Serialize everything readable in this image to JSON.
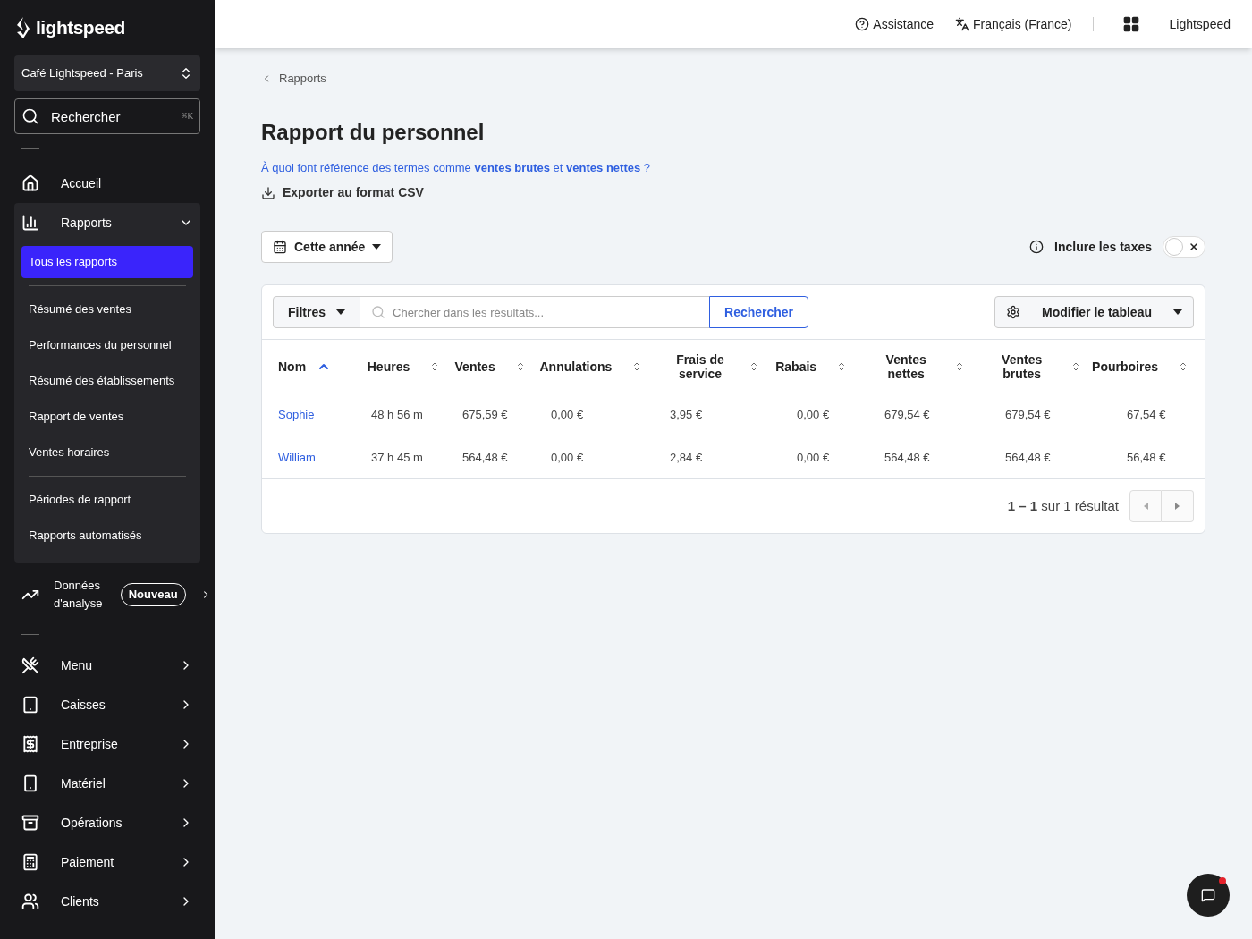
{
  "sidebar": {
    "logo": "lightspeed",
    "location": "Café Lightspeed - Paris",
    "search": {
      "placeholder": "Rechercher",
      "shortcut": "⌘K"
    },
    "items": [
      {
        "kind": "link",
        "label": "Accueil"
      },
      {
        "kind": "group",
        "label": "Rapports",
        "expanded": true,
        "sections": [
          [
            {
              "label": "Tous les rapports",
              "selected": true
            }
          ],
          [
            {
              "label": "Résumé des ventes",
              "selected": false
            },
            {
              "label": "Performances du personnel",
              "selected": false
            },
            {
              "label": "Résumé des établissements",
              "selected": false
            },
            {
              "label": "Rapport de ventes",
              "selected": false
            },
            {
              "label": "Ventes horaires",
              "selected": false
            }
          ],
          [
            {
              "label": "Périodes de rapport",
              "selected": false
            },
            {
              "label": "Rapports automatisés",
              "selected": false
            }
          ]
        ]
      },
      {
        "kind": "badge",
        "label": "Données d'analyse",
        "badge": "Nouveau"
      },
      {
        "kind": "divider"
      },
      {
        "kind": "submenu",
        "label": "Menu"
      },
      {
        "kind": "submenu",
        "label": "Caisses"
      },
      {
        "kind": "submenu",
        "label": "Entreprise"
      },
      {
        "kind": "submenu",
        "label": "Matériel"
      },
      {
        "kind": "submenu",
        "label": "Opérations"
      },
      {
        "kind": "submenu",
        "label": "Paiement"
      },
      {
        "kind": "submenu",
        "label": "Clients"
      }
    ]
  },
  "topbar": {
    "help": "Assistance",
    "language": "Français (France)",
    "account": "Lightspeed"
  },
  "breadcrumb": "Rapports",
  "title": "Rapport du personnel",
  "help_link": "À quoi font référence des termes comme **ventes brutes** et **ventes nettes** ?",
  "export": "Exporter au format CSV",
  "period": "Cette année",
  "taxes": {
    "label": "Inclure les taxes",
    "on": false
  },
  "toolbar": {
    "filters": "Filtres",
    "search_placeholder": "Chercher dans les résultats...",
    "search_button": "Rechercher",
    "edit_table": "Modifier le tableau"
  },
  "table": {
    "columns": [
      {
        "label": "Nom",
        "sorted": true
      },
      {
        "label": "Heures",
        "sorted": false
      },
      {
        "label": "Ventes",
        "sorted": false
      },
      {
        "label": "Annulations",
        "sorted": false
      },
      {
        "label": "Frais de service",
        "sorted": false
      },
      {
        "label": "Rabais",
        "sorted": false
      },
      {
        "label": "Ventes nettes",
        "sorted": false
      },
      {
        "label": "Ventes brutes",
        "sorted": false
      },
      {
        "label": "Pourboires",
        "sorted": false
      }
    ],
    "rows": [
      [
        "Sophie",
        "48 h 56 m",
        "675,59 €",
        "0,00 €",
        "3,95 €",
        "0,00 €",
        "679,54 €",
        "679,54 €",
        "67,54 €"
      ],
      [
        "William",
        "37 h 45 m",
        "564,48 €",
        "0,00 €",
        "2,84 €",
        "0,00 €",
        "564,48 €",
        "564,48 €",
        "56,48 €"
      ]
    ]
  },
  "pagination": "**1 – 1** sur 1 résultat"
}
